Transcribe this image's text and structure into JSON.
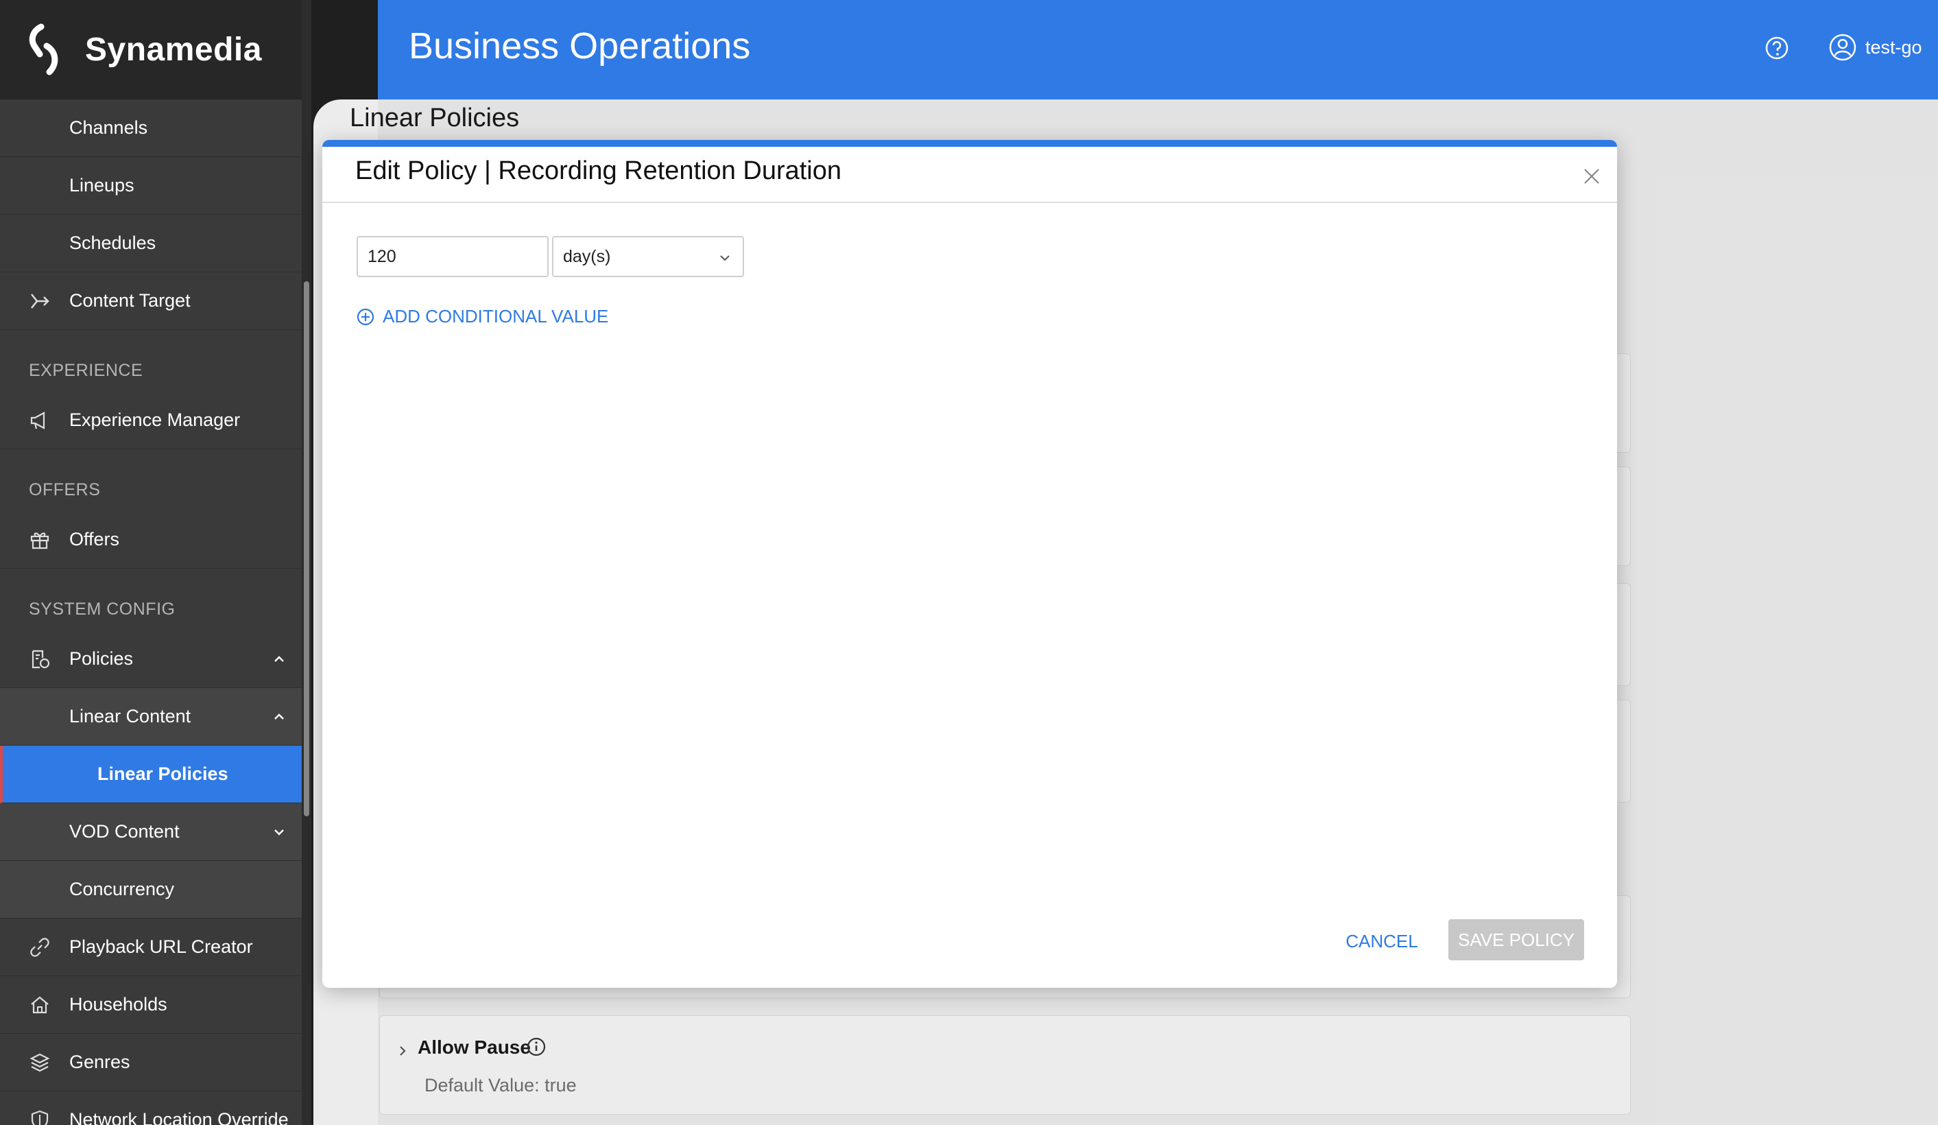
{
  "brand": {
    "name": "Synamedia"
  },
  "header": {
    "title": "Business Operations",
    "user_name": "test-go"
  },
  "sidebar": {
    "items_top": [
      {
        "label": "Channels"
      },
      {
        "label": "Lineups"
      },
      {
        "label": "Schedules"
      },
      {
        "label": "Content Target",
        "icon": "arrow-enter-icon"
      }
    ],
    "section_experience": "EXPERIENCE",
    "experience_manager": "Experience Manager",
    "section_offers": "OFFERS",
    "offers": "Offers",
    "section_system": "SYSTEM CONFIG",
    "policies": "Policies",
    "linear_content": "Linear Content",
    "linear_policies": "Linear Policies",
    "vod_content": "VOD Content",
    "concurrency": "Concurrency",
    "playback_url_creator": "Playback URL Creator",
    "households": "Households",
    "genres": "Genres",
    "network_location_override": "Network Location Override"
  },
  "content": {
    "page_title": "Linear Policies",
    "policy_card": {
      "name": "Allow Pause",
      "default_value": "Default Value: true"
    }
  },
  "modal": {
    "title": "Edit Policy | Recording Retention Duration",
    "value": "120",
    "unit": "day(s)",
    "add_conditional": "ADD CONDITIONAL VALUE",
    "cancel": "CANCEL",
    "save": "SAVE POLICY"
  },
  "colors": {
    "accent": "#2f7ae5",
    "sidebar_bg": "#3a3a3a",
    "active_marker": "#d84a4a"
  }
}
